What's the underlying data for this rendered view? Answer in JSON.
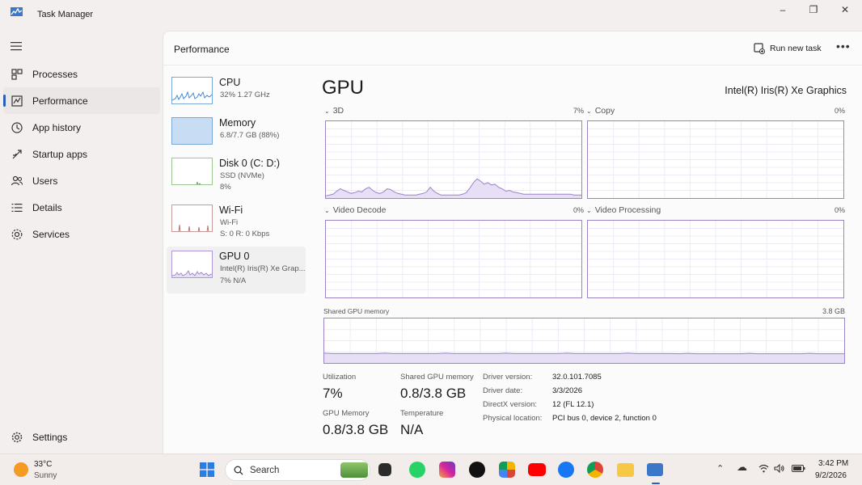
{
  "window": {
    "title": "Task Manager",
    "minimize": "–",
    "maximize": "❐",
    "close": "✕"
  },
  "nav": {
    "items": [
      {
        "label": "Processes",
        "icon": "processes-icon"
      },
      {
        "label": "Performance",
        "icon": "performance-icon"
      },
      {
        "label": "App history",
        "icon": "app-history-icon"
      },
      {
        "label": "Startup apps",
        "icon": "startup-apps-icon"
      },
      {
        "label": "Users",
        "icon": "users-icon"
      },
      {
        "label": "Details",
        "icon": "details-icon"
      },
      {
        "label": "Services",
        "icon": "services-icon"
      }
    ],
    "active": "Performance",
    "settings": "Settings"
  },
  "header": {
    "title": "Performance",
    "run_new_task": "Run new task",
    "more": "•••"
  },
  "devices": [
    {
      "name": "CPU",
      "line1": "32%  1.27 GHz",
      "line2": ""
    },
    {
      "name": "Memory",
      "line1": "6.8/7.7 GB (88%)",
      "line2": ""
    },
    {
      "name": "Disk 0 (C: D:)",
      "line1": "SSD (NVMe)",
      "line2": "8%"
    },
    {
      "name": "Wi-Fi",
      "line1": "Wi-Fi",
      "line2": "S: 0  R: 0 Kbps"
    },
    {
      "name": "GPU 0",
      "line1": "Intel(R) Iris(R) Xe Grap...",
      "line2": "7%  N/A"
    }
  ],
  "gpu": {
    "title": "GPU",
    "model": "Intel(R) Iris(R) Xe Graphics",
    "engines": [
      {
        "label": "3D",
        "pct": "7%"
      },
      {
        "label": "Copy",
        "pct": "0%"
      },
      {
        "label": "Video Decode",
        "pct": "0%"
      },
      {
        "label": "Video Processing",
        "pct": "0%"
      }
    ],
    "shared_memory": {
      "label": "Shared GPU memory",
      "max": "3.8 GB"
    },
    "stats": {
      "utilization_label": "Utilization",
      "utilization": "7%",
      "shared_label": "Shared GPU memory",
      "shared": "0.8/3.8 GB",
      "gpu_memory_label": "GPU Memory",
      "gpu_memory": "0.8/3.8 GB",
      "temperature_label": "Temperature",
      "temperature": "N/A"
    },
    "info": [
      {
        "label": "Driver version:",
        "value": "32.0.101.7085"
      },
      {
        "label": "Driver date:",
        "value": "3/3/2026"
      },
      {
        "label": "DirectX version:",
        "value": "12 (FL 12.1)"
      },
      {
        "label": "Physical location:",
        "value": "PCI bus 0, device 2, function 0"
      }
    ],
    "chart_3d_values": [
      3,
      4,
      5,
      9,
      12,
      10,
      8,
      6,
      7,
      9,
      8,
      12,
      14,
      10,
      7,
      6,
      8,
      12,
      11,
      8,
      6,
      5,
      4,
      4,
      4,
      4,
      5,
      6,
      8,
      14,
      9,
      6,
      4,
      4,
      4,
      4,
      4,
      4,
      5,
      7,
      13,
      20,
      25,
      22,
      18,
      20,
      17,
      18,
      14,
      12,
      9,
      10,
      8,
      7,
      6,
      5,
      5,
      5,
      5,
      5,
      5,
      5,
      5,
      5,
      5,
      5,
      5,
      5,
      5,
      4,
      4,
      4
    ]
  },
  "taskbar": {
    "temperature": "33°C",
    "condition": "Sunny",
    "search": "Search",
    "time": "3:42 PM",
    "date": "9/2/2026"
  },
  "colors": {
    "accent": "#2b5fb3",
    "gpu_line": "#9a84c8",
    "gpu_fill": "#e7dff5"
  }
}
